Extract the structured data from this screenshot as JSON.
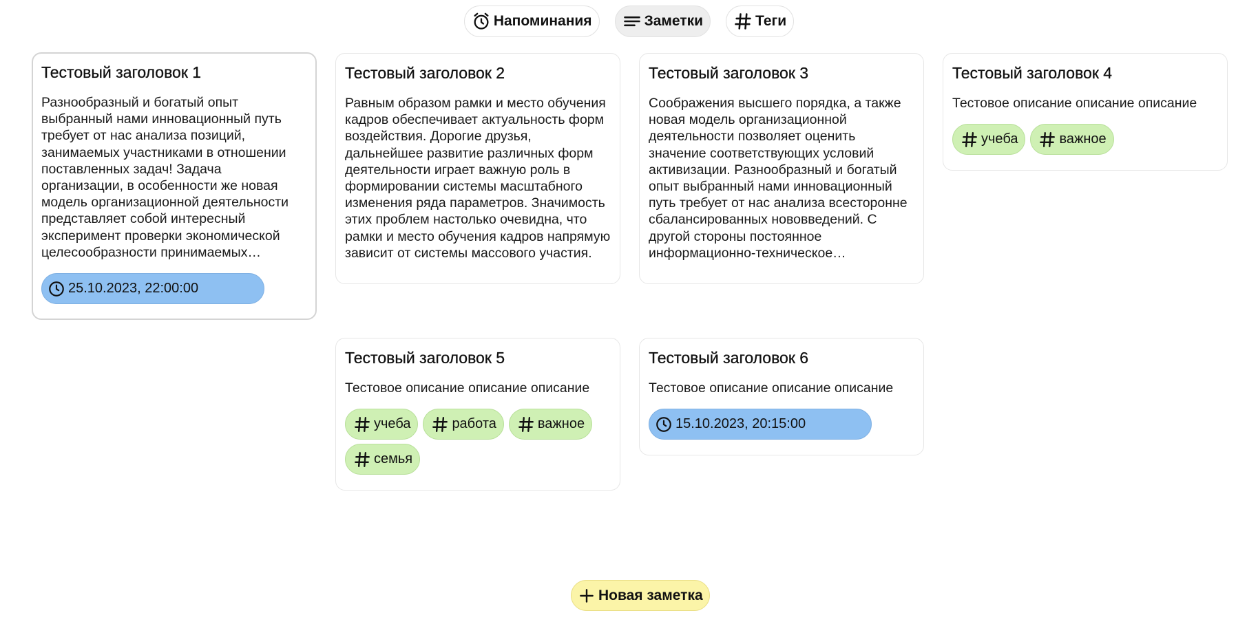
{
  "nav": {
    "reminders": {
      "label": "Напоминания",
      "icon": "alarm-clock-icon"
    },
    "notes": {
      "label": "Заметки",
      "icon": "lines-icon"
    },
    "tags": {
      "label": "Теги",
      "icon": "hash-icon"
    }
  },
  "cards": [
    {
      "title": "Тестовый заголовок 1",
      "description": "Разнообразный и богатый опыт выбранный нами инновационный путь требует от нас анализа позиций, занимаемых участниками в отношении поставленных задач! Задача организации, в особенности же новая модель организационной деятельности представляет собой интересный эксперимент проверки экономической целесообразности принимаемых решений.",
      "date": "25.10.2023, 22:00:00"
    },
    {
      "title": "Тестовый заголовок 2",
      "description": "Равным образом рамки и место обучения кадров обеспечивает актуальность форм воздействия. Дорогие друзья, дальнейшее развитие различных форм деятельности играет важную роль в формировании системы масштабного изменения ряда параметров. Значимость этих проблем настолько очевидна, что рамки и место обучения кадров напрямую зависит от системы массового участия."
    },
    {
      "title": "Тестовый заголовок 3",
      "description": "Соображения высшего порядка, а также новая модель организационной деятельности позволяет оценить значение соответствующих условий активизации. Разнообразный и богатый опыт выбранный нами инновационный путь требует от нас анализа всесторонне сбалансированных нововведений. С другой стороны постоянное информационно-техническое обеспечение нашей деятельности."
    },
    {
      "title": "Тестовый заголовок 4",
      "description": "Тестовое описание описание описание",
      "tags": [
        "учеба",
        "важное"
      ]
    },
    {
      "title": "Тестовый заголовок 5",
      "description": "Тестовое описание описание описание",
      "tags": [
        "учеба",
        "работа",
        "важное",
        "семья"
      ]
    },
    {
      "title": "Тестовый заголовок 6",
      "description": "Тестовое описание описание описание",
      "date": "15.10.2023, 20:15:00"
    }
  ],
  "new_note": {
    "label": "Новая заметка",
    "icon": "plus-icon"
  },
  "colors": {
    "tag_chip": "#cff0b4",
    "date_chip": "#8ec0f2",
    "new_note_button": "#fbf4a8",
    "active_nav": "#eeeeee"
  }
}
